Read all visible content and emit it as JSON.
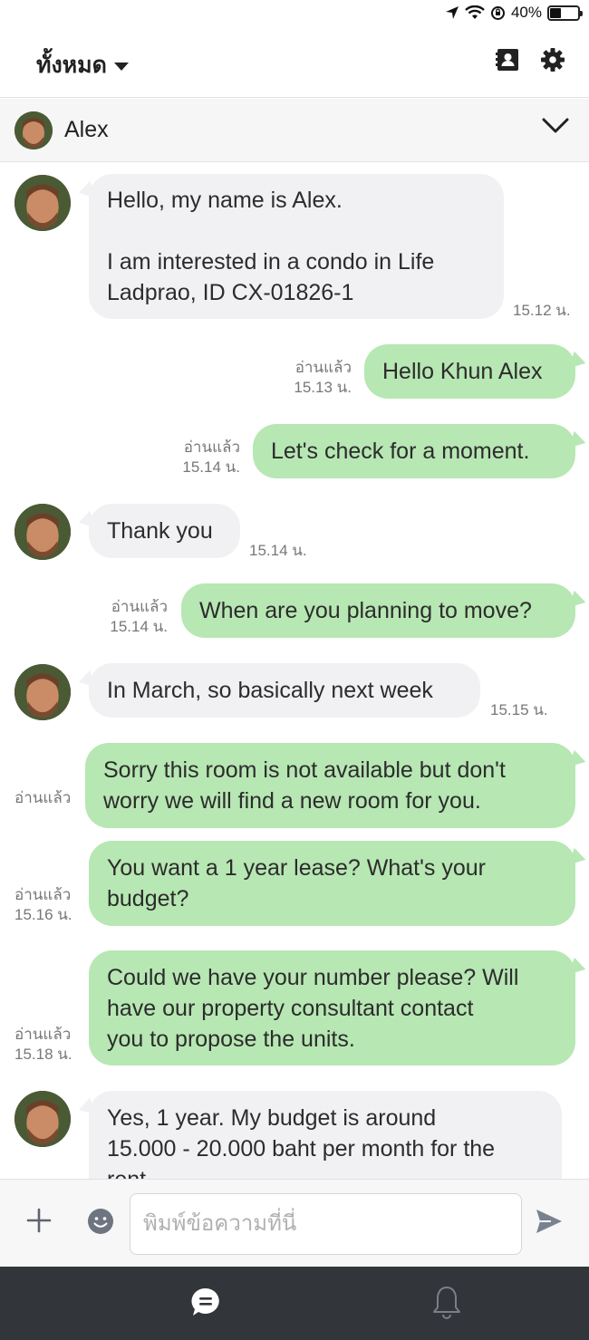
{
  "status_bar": {
    "battery_text": "40%",
    "battery_level": 0.4,
    "icons": [
      "location-arrow-icon",
      "wifi-icon",
      "orientation-lock-icon",
      "battery-icon"
    ]
  },
  "header": {
    "filter_label": "ทั้งหมด",
    "icons": [
      "contact-card-icon",
      "gear-icon"
    ]
  },
  "conversation": {
    "name": "Alex",
    "chevron": "chevron-down-icon"
  },
  "messages": [
    {
      "id": "m1",
      "dir": "in",
      "text_lines": [
        "Hello, my name is Alex.",
        "",
        "I am interested in a condo in Life",
        "Ladprao, ID CX-01826-1"
      ],
      "time": "15.12 น."
    },
    {
      "id": "m2",
      "dir": "out",
      "text": "Hello Khun Alex",
      "read": "อ่านแล้ว",
      "time": "15.13 น."
    },
    {
      "id": "m3",
      "dir": "out",
      "text": "Let's check for a moment.",
      "read": "อ่านแล้ว",
      "time": "15.14 น."
    },
    {
      "id": "m4",
      "dir": "in",
      "text": "Thank you",
      "time": "15.14 น."
    },
    {
      "id": "m5",
      "dir": "out",
      "text": "When are you planning to move?",
      "read": "อ่านแล้ว",
      "time": "15.14 น."
    },
    {
      "id": "m6",
      "dir": "in",
      "text": "In March, so basically next week",
      "time": "15.15 น."
    },
    {
      "id": "m7",
      "dir": "out",
      "text_lines": [
        "Sorry this room is not available but don't",
        "worry we will find a new room for you."
      ],
      "read": "อ่านแล้ว",
      "time": ""
    },
    {
      "id": "m8",
      "dir": "out",
      "text_lines": [
        "You want a 1 year lease? What's your",
        "budget?"
      ],
      "read": "อ่านแล้ว",
      "time": "15.16 น."
    },
    {
      "id": "m9",
      "dir": "out",
      "text_lines": [
        "Could we have your number please? Will",
        "have our property consultant contact",
        "you to propose the units."
      ],
      "read": "อ่านแล้ว",
      "time": "15.18 น."
    },
    {
      "id": "m10",
      "dir": "in",
      "text_lines": [
        "Yes, 1 year. My budget is around",
        "15.000 - 20.000 baht per month for the",
        "rent."
      ],
      "time": ""
    }
  ],
  "composer": {
    "placeholder": "พิมพ์ข้อความที่นี่",
    "value": "",
    "icons": [
      "plus-icon",
      "emoji-icon",
      "send-icon"
    ]
  },
  "bottom_nav": {
    "items": [
      {
        "name": "chat-tab",
        "icon": "chat-bubble-icon",
        "active": true
      },
      {
        "name": "notifications-tab",
        "icon": "bell-icon",
        "active": false
      }
    ]
  },
  "colors": {
    "incoming_bubble": "#f1f1f3",
    "outgoing_bubble": "#b7e7b3",
    "bottom_nav": "#32353a",
    "send_icon": "#7a8290"
  }
}
